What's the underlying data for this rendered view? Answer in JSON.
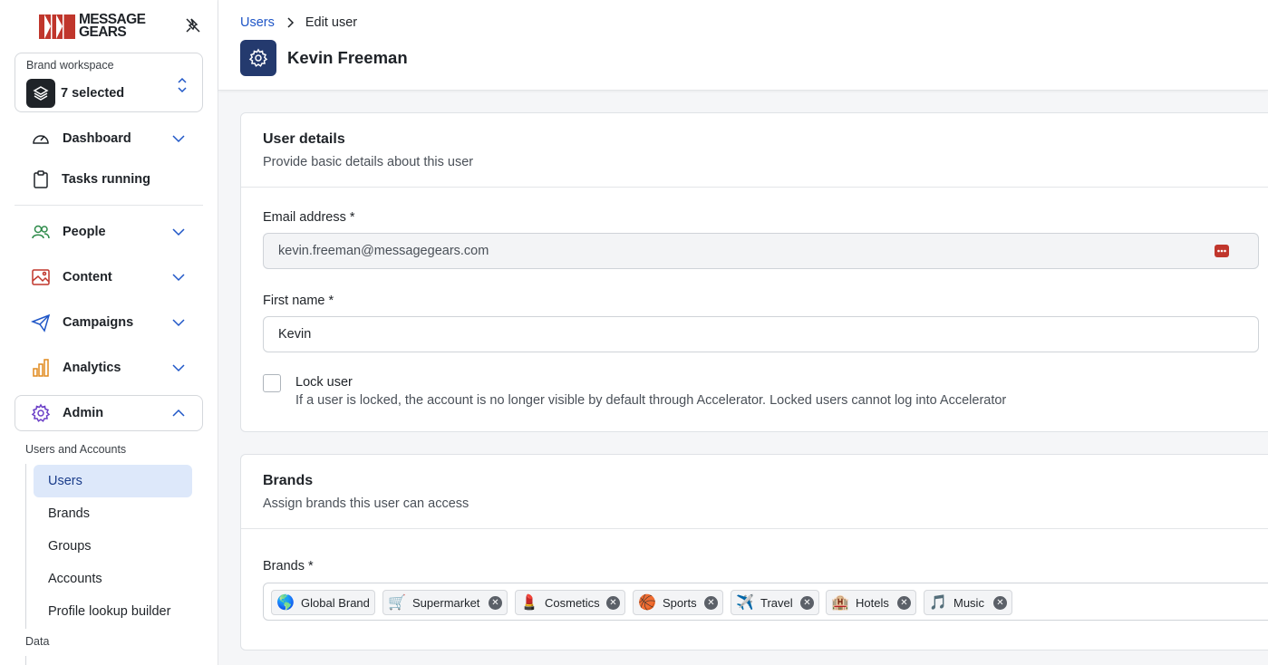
{
  "app": {
    "logo_line1": "MESSAGE",
    "logo_line2": "GEARS",
    "brand_color": "#c0362c"
  },
  "workspace": {
    "label": "Brand workspace",
    "value": "7 selected"
  },
  "nav": {
    "dashboard": "Dashboard",
    "tasks": "Tasks running",
    "people": "People",
    "content": "Content",
    "campaigns": "Campaigns",
    "analytics": "Analytics",
    "admin": "Admin"
  },
  "admin_sections": {
    "users_accounts": "Users and Accounts",
    "items": [
      "Users",
      "Brands",
      "Groups",
      "Accounts",
      "Profile lookup builder"
    ],
    "data": "Data"
  },
  "breadcrumb": {
    "parent": "Users",
    "current": "Edit user"
  },
  "page_title": "Kevin Freeman",
  "user_details": {
    "title": "User details",
    "subtitle": "Provide basic details about this user",
    "email_label": "Email address *",
    "email_value": "kevin.freeman@messagegears.com",
    "first_name_label": "First name *",
    "first_name_value": "Kevin",
    "lock_label": "Lock user",
    "lock_help": "If a user is locked, the account is no longer visible by default through Accelerator. Locked users cannot log into Accelerator",
    "lock_checked": false
  },
  "brands": {
    "title": "Brands",
    "subtitle": "Assign brands this user can access",
    "field_label": "Brands *",
    "chips": [
      {
        "label": "Global Brand",
        "emoji": "🌎",
        "removable": false
      },
      {
        "label": "Supermarket",
        "emoji": "🛒",
        "removable": true
      },
      {
        "label": "Cosmetics",
        "emoji": "💄",
        "removable": true
      },
      {
        "label": "Sports",
        "emoji": "🏀",
        "removable": true
      },
      {
        "label": "Travel",
        "emoji": "✈️",
        "removable": true
      },
      {
        "label": "Hotels",
        "emoji": "🏨",
        "removable": true
      },
      {
        "label": "Music",
        "emoji": "🎵",
        "removable": true
      }
    ]
  }
}
